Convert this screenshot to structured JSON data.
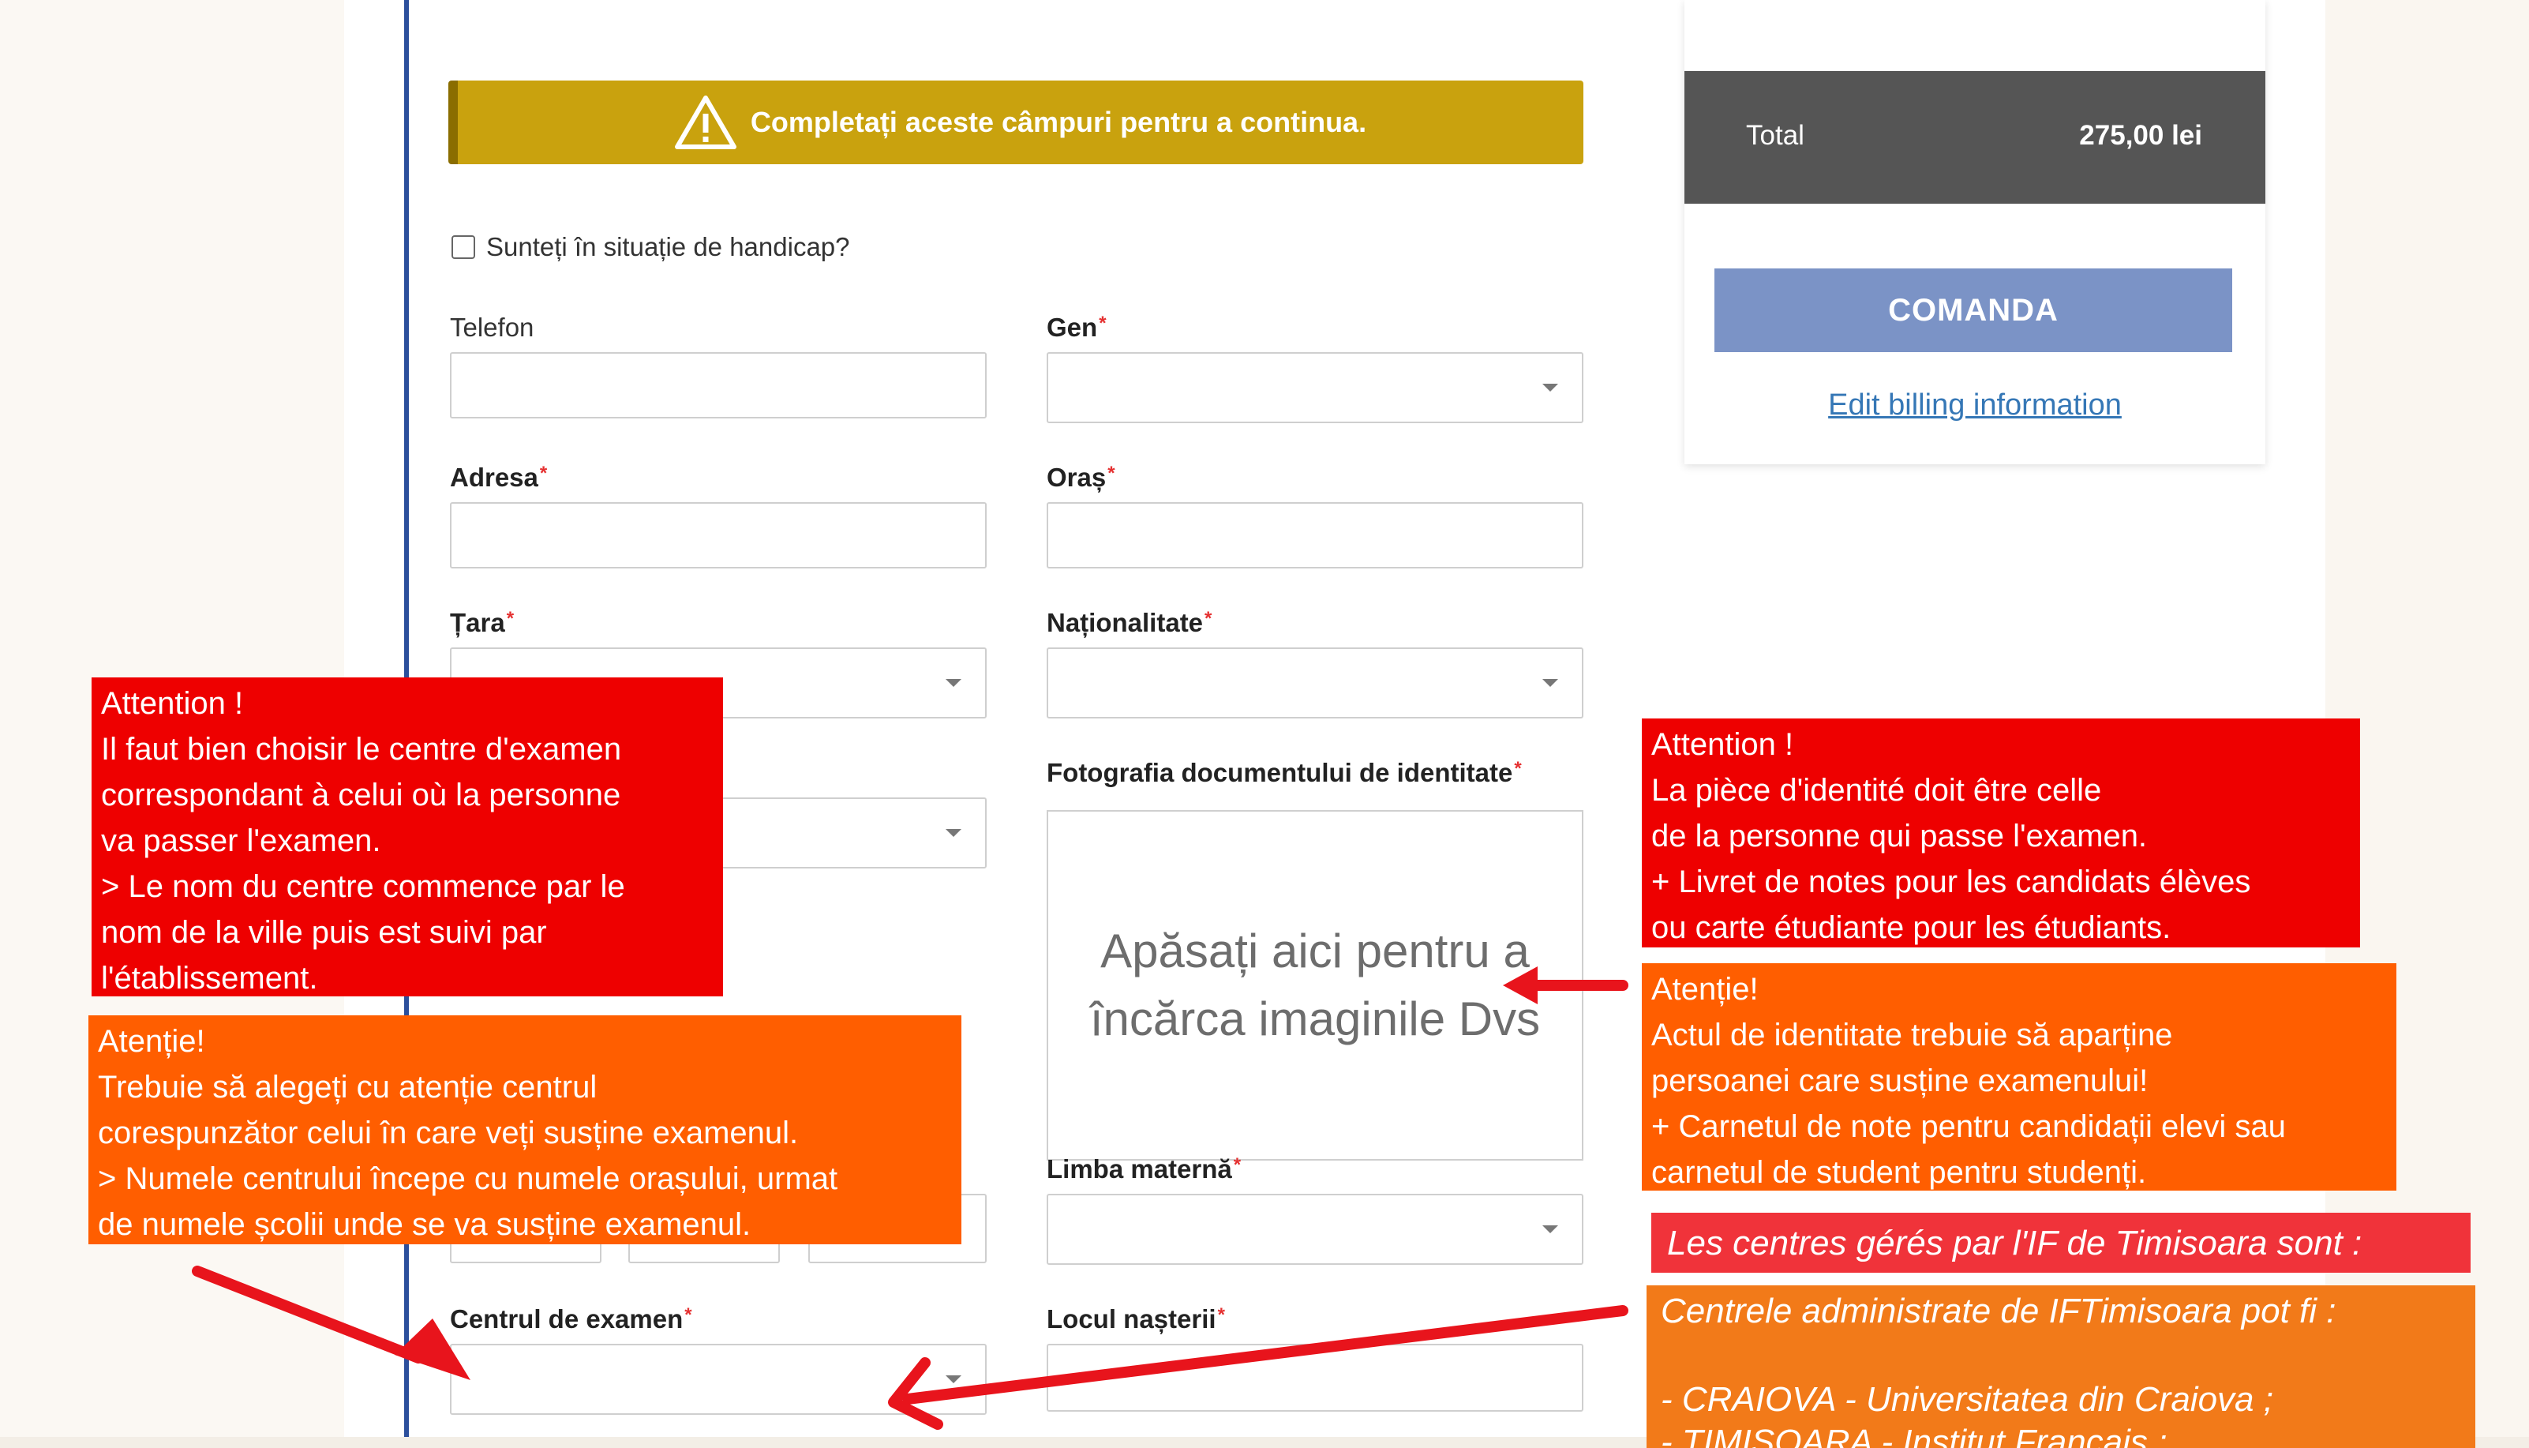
{
  "alert": {
    "text": "Completați aceste câmpuri pentru a continua."
  },
  "handicap": {
    "label": "Sunteți în situație de handicap?"
  },
  "fields": {
    "telefon": "Telefon",
    "gen": "Gen",
    "adresa": "Adresa",
    "oras": "Oraș",
    "tara": "Țara",
    "nationalitate": "Naționalitate",
    "fotografia": "Fotografia documentului de identitate",
    "limba": "Limba maternă",
    "centrul": "Centrul de examen",
    "locul": "Locul nașterii"
  },
  "required_mark": "*",
  "upload": {
    "text": "Apăsați aici pentru a încărca imaginile Dvs"
  },
  "summary": {
    "total_label": "Total",
    "total_value": "275,00 lei",
    "order_button": "COMANDA",
    "edit_link": "Edit billing information"
  },
  "notes": {
    "fr_center": "Attention !\nIl faut bien choisir le centre d'examen\ncorrespondant à celui où la personne\nva passer l'examen.\n> Le nom du centre commence par le\nnom de la ville puis est suivi par\nl'établissement.",
    "ro_center": "Atenție!\nTrebuie să alegeți cu atenție centrul\ncorespunzător celui în care veți susține examenul.\n> Numele centrului începe cu numele orașului, urmat\nde numele școlii unde se va susține examenul.",
    "fr_id": "Attention !\nLa pièce d'identité doit être celle\nde la personne qui passe l'examen.\n+ Livret de notes pour les candidats élèves\nou carte étudiante pour les étudiants.",
    "ro_id": "Atenție!\n Actul de identitate trebuie să aparține\npersoanei care susține examenului!\n+ Carnetul de note pentru candidații elevi sau\ncarnetul de student pentru studenți.",
    "fr_centres": "Les centres gérés par l'IF de Timisoara sont :",
    "ro_centres_title": "Centrele administrate de IFTimisoara pot fi :",
    "ro_centres_items": [
      "- CRAIOVA - Universitatea din Craiova ;",
      "- TIMIȘOARA - Institut Français ;"
    ]
  },
  "colors": {
    "alert": "#c9a20e",
    "total_bar": "#555555",
    "order_button": "#7b93c6",
    "link": "#3577b6",
    "note_red": "#ee0000",
    "note_orange": "#ff5e00",
    "arrow": "#e8141c"
  }
}
